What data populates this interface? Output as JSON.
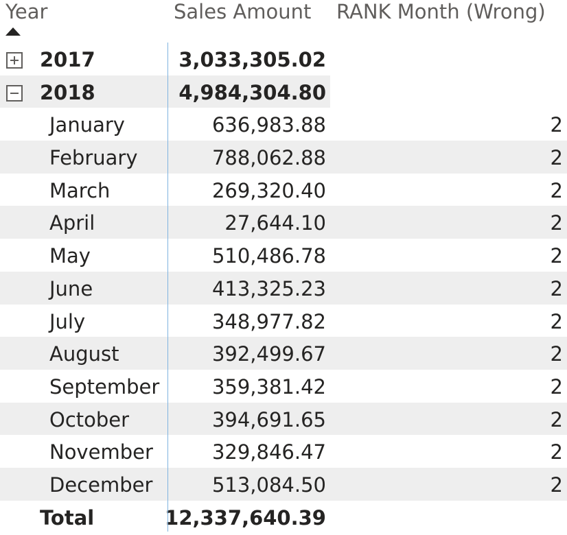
{
  "headers": {
    "year": "Year",
    "sales": "Sales Amount",
    "rank": "RANK Month (Wrong)"
  },
  "years": [
    {
      "label": "2017",
      "amount": "3,033,305.02",
      "toggle": "expand"
    },
    {
      "label": "2018",
      "amount": "4,984,304.80",
      "toggle": "collapse"
    }
  ],
  "months": [
    {
      "label": "January",
      "amount": "636,983.88",
      "rank": "2"
    },
    {
      "label": "February",
      "amount": "788,062.88",
      "rank": "2"
    },
    {
      "label": "March",
      "amount": "269,320.40",
      "rank": "2"
    },
    {
      "label": "April",
      "amount": "27,644.10",
      "rank": "2"
    },
    {
      "label": "May",
      "amount": "510,486.78",
      "rank": "2"
    },
    {
      "label": "June",
      "amount": "413,325.23",
      "rank": "2"
    },
    {
      "label": "July",
      "amount": "348,977.82",
      "rank": "2"
    },
    {
      "label": "August",
      "amount": "392,499.67",
      "rank": "2"
    },
    {
      "label": "September",
      "amount": "359,381.42",
      "rank": "2"
    },
    {
      "label": "October",
      "amount": "394,691.65",
      "rank": "2"
    },
    {
      "label": "November",
      "amount": "329,846.47",
      "rank": "2"
    },
    {
      "label": "December",
      "amount": "513,084.50",
      "rank": "2"
    }
  ],
  "total": {
    "label": "Total",
    "amount": "12,337,640.39"
  },
  "colors": {
    "text": "#252423",
    "header_text": "#605e5c",
    "row_shade": "#eeeeee",
    "divider": "#7fb3e0"
  },
  "icons": {
    "sort": "sort-ascending-icon",
    "expand": "expand-plus-icon",
    "collapse": "collapse-minus-icon"
  }
}
